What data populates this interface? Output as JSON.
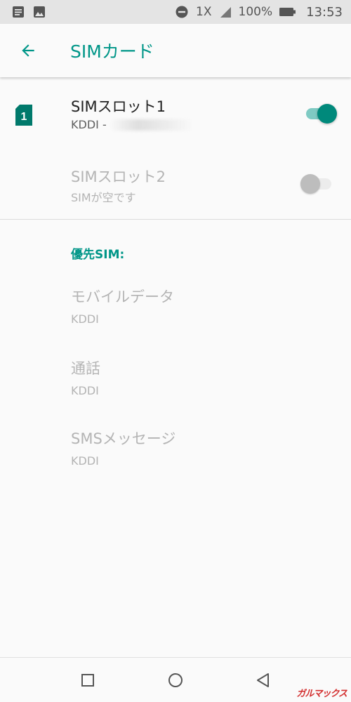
{
  "status_bar": {
    "network": "1X",
    "battery": "100%",
    "time": "13:53"
  },
  "app_bar": {
    "title": "SIMカード"
  },
  "sim_slots": [
    {
      "label": "SIMスロット1",
      "carrier": "KDDI -",
      "icon_number": "1",
      "enabled": true
    },
    {
      "label": "SIMスロット2",
      "status": "SIMが空です",
      "enabled": false
    }
  ],
  "preferred_sim": {
    "header": "優先SIM:",
    "items": [
      {
        "title": "モバイルデータ",
        "value": "KDDI"
      },
      {
        "title": "通話",
        "value": "KDDI"
      },
      {
        "title": "SMSメッセージ",
        "value": "KDDI"
      }
    ]
  },
  "watermark": "ガルマックス",
  "colors": {
    "accent": "#009688",
    "status_bar": "#e4e4e4",
    "disabled_text": "#b4b4b4"
  },
  "icons": [
    "notification-icon",
    "image-icon",
    "dnd-icon",
    "signal-icon",
    "battery-icon",
    "back-arrow-icon",
    "sim-card-icon",
    "recents-icon",
    "home-icon",
    "back-nav-icon"
  ]
}
